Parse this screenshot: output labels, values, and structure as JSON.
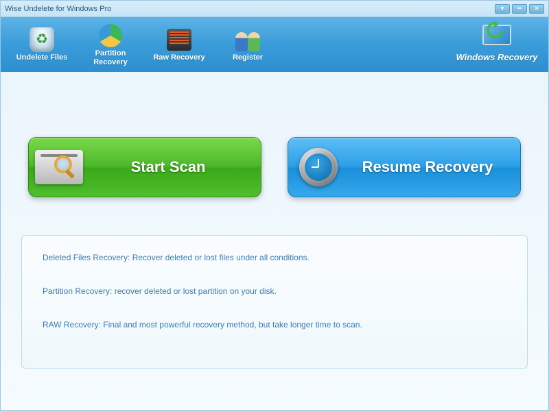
{
  "title": "Wise Undelete for Windows Pro",
  "toolbar": {
    "undelete": "Undelete Files",
    "partition": "Partition\nRecovery",
    "raw": "Raw Recovery",
    "register": "Register",
    "windows_recovery": "Windows Recovery"
  },
  "actions": {
    "scan": "Start  Scan",
    "resume": "Resume Recovery"
  },
  "info": {
    "deleted": "Deleted Files Recovery: Recover deleted or lost files  under all conditions.",
    "partition": "Partition Recovery: recover deleted or lost partition on your disk.",
    "raw": "RAW Recovery: Final and most powerful recovery method, but take longer time to scan."
  }
}
